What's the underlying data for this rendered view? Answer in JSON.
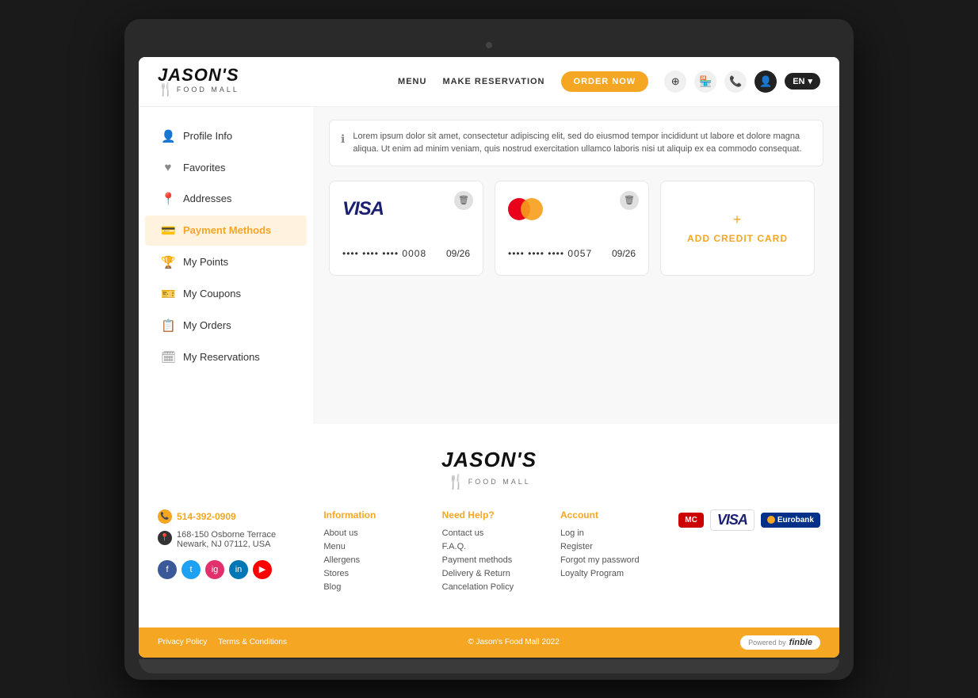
{
  "header": {
    "logo_name": "JASON'S",
    "logo_sub": "FOOD MALL",
    "nav": {
      "menu_label": "MENU",
      "reservation_label": "MAKE RESERVATION",
      "order_label": "ORDER NOW",
      "lang": "EN"
    }
  },
  "sidebar": {
    "items": [
      {
        "id": "profile",
        "label": "Profile Info",
        "icon": "👤"
      },
      {
        "id": "favorites",
        "label": "Favorites",
        "icon": "♥"
      },
      {
        "id": "addresses",
        "label": "Addresses",
        "icon": "📍"
      },
      {
        "id": "payment",
        "label": "Payment Methods",
        "icon": "💳",
        "active": true
      },
      {
        "id": "points",
        "label": "My Points",
        "icon": "🏆"
      },
      {
        "id": "coupons",
        "label": "My Coupons",
        "icon": "🎫"
      },
      {
        "id": "orders",
        "label": "My Orders",
        "icon": "📋"
      },
      {
        "id": "reservations",
        "label": "My Reservations",
        "icon": "🗓"
      }
    ]
  },
  "content": {
    "banner_text": "Lorem ipsum dolor sit amet, consectetur adipiscing elit, sed do eiusmod tempor incididunt ut labore et dolore magna aliqua. Ut enim ad minim veniam, quis nostrud exercitation ullamco laboris nisi ut aliquip ex ea commodo consequat.",
    "cards": [
      {
        "type": "visa",
        "number": "•••• •••• •••• 0008",
        "expiry": "09/26"
      },
      {
        "type": "mastercard",
        "number": "•••• •••• •••• 0057",
        "expiry": "09/26"
      }
    ],
    "add_card_label": "ADD CREDIT CARD"
  },
  "footer": {
    "logo_name": "JASON'S",
    "logo_sub": "FOOD MALL",
    "phone": "514-392-0909",
    "address_line1": "168-150 Osborne Terrace",
    "address_line2": "Newark, NJ 07112, USA",
    "socials": [
      "f",
      "t",
      "ig",
      "in",
      "yt"
    ],
    "columns": [
      {
        "heading": "Information",
        "links": [
          "About us",
          "Menu",
          "Allergens",
          "Stores",
          "Blog"
        ]
      },
      {
        "heading": "Need Help?",
        "links": [
          "Contact us",
          "F.A.Q.",
          "Payment methods",
          "Delivery & Return",
          "Cancelation Policy"
        ]
      },
      {
        "heading": "Account",
        "links": [
          "Log in",
          "Register",
          "Forgot my password",
          "Loyalty Program"
        ]
      }
    ],
    "bar": {
      "privacy": "Privacy Policy",
      "terms": "Terms & Conditions",
      "copyright": "© Jason's Food Mall 2022",
      "powered_by": "Powered by",
      "powered_brand": "finble"
    }
  }
}
